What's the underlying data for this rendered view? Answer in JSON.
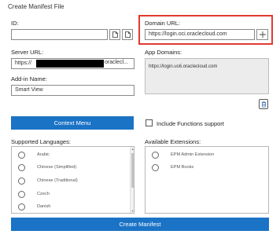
{
  "dialog": {
    "title": "Create Manifest File"
  },
  "id_field": {
    "label": "ID:",
    "value": ""
  },
  "domain_url": {
    "label": "Domain URL:",
    "value": "https://login.oci.oraclecloud.com"
  },
  "server_url": {
    "label": "Server URL:",
    "value_prefix": "https://",
    "value_suffix": "oraclecl..."
  },
  "app_domains": {
    "label": "App Domains:",
    "items": [
      "https://login.us6.oraclecloud.com"
    ]
  },
  "addin_name": {
    "label": "Add-in Name:",
    "value": "Smart View"
  },
  "context_menu_button": "Context Menu",
  "include_functions": {
    "label": "Include Functions support",
    "checked": false
  },
  "supported_languages": {
    "label": "Supported Languages:",
    "items": [
      "Arabic",
      "Chinese (Simplified)",
      "Chinese (Traditional)",
      "Czech",
      "Danish"
    ]
  },
  "available_extensions": {
    "label": "Available Extensions:",
    "items": [
      "EPM Admin Extension",
      "EPM Books"
    ]
  },
  "create_manifest_button": "Create Manifest",
  "colors": {
    "accent": "#1b73c6",
    "highlight": "#e03a2f"
  },
  "icons": {
    "id_copy": "copy-icon",
    "id_file": "file-icon",
    "domain_add": "plus-icon",
    "app_domains_delete": "trash-icon"
  }
}
